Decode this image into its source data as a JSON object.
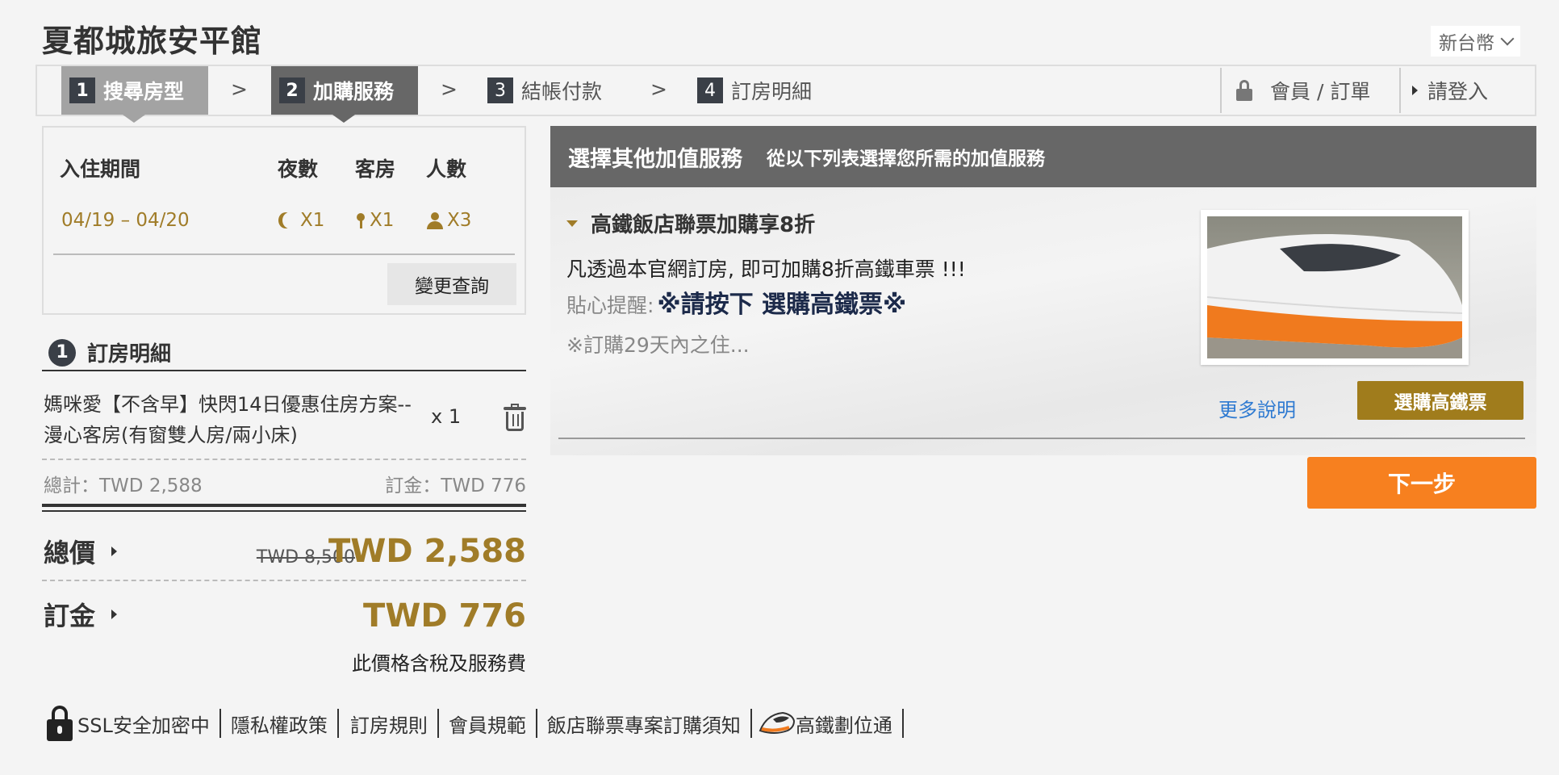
{
  "header": {
    "hotel_name": "夏都城旅安平館",
    "currency": "新台幣"
  },
  "steps": [
    {
      "num": "1",
      "label": "搜尋房型"
    },
    {
      "num": "2",
      "label": "加購服務"
    },
    {
      "num": "3",
      "label": "結帳付款"
    },
    {
      "num": "4",
      "label": "訂房明細"
    }
  ],
  "step_separator": ">",
  "nav": {
    "member": "會員 / 訂單",
    "login": "請登入"
  },
  "stay": {
    "headers": {
      "period": "入住期間",
      "nights": "夜數",
      "rooms": "客房",
      "people": "人數"
    },
    "period": "04/19 – 04/20",
    "nights": "X1",
    "rooms": "X1",
    "people": "X3",
    "change_button": "變更查詢"
  },
  "order": {
    "step_num": "1",
    "title": "訂房明細",
    "room_name": "媽咪愛【不含早】快閃14日優惠住房方案--漫心客房(有窗雙人房/兩小床)",
    "qty": "x 1",
    "subtotal": "總計：TWD 2,588",
    "deposit_small": "訂金：TWD 776",
    "total_label": "總價",
    "total_old": "TWD 8,500",
    "total_new": "TWD 2,588",
    "deposit_label": "訂金",
    "deposit_amount": "TWD 776",
    "tax_note": "此價格含稅及服務費"
  },
  "addon": {
    "header_title": "選擇其他加值服務",
    "header_subtitle": "從以下列表選擇您所需的加值服務",
    "offer_title": "高鐵飯店聯票加購享8折",
    "offer_desc": "凡透過本官網訂房, 即可加購8折高鐵車票 !!!",
    "tip_label": "貼心提醒:",
    "tip_strong": "※請按下 選購高鐵票※",
    "more_note": "※訂購29天內之住...",
    "more_link": "更多說明",
    "buy_button": "選購高鐵票",
    "next_button": "下一步"
  },
  "footer": {
    "ssl": "SSL安全加密中",
    "privacy": "隱私權政策",
    "rules": "訂房規則",
    "member_terms": "會員規範",
    "package_notice": "飯店聯票專案訂購須知",
    "thsr": "高鐵劃位通"
  },
  "colors": {
    "accent_gold": "#a07c28",
    "next_orange": "#f7801f",
    "buy_gold": "#a07c1c",
    "header_gray": "#676767",
    "link_blue": "#2e7ad1"
  }
}
